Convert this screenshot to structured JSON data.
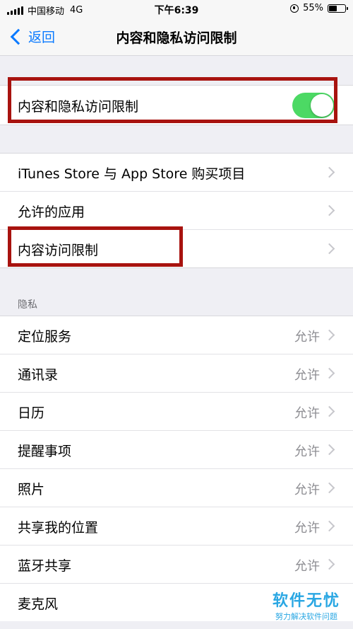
{
  "status_bar": {
    "carrier": "中国移动",
    "network": "4G",
    "time": "下午6:39",
    "battery": "55%",
    "battery_level": 0.55
  },
  "nav": {
    "back_label": "返回",
    "title": "内容和隐私访问限制"
  },
  "toggle_row": {
    "label": "内容和隐私访问限制",
    "enabled": true,
    "accent": "#4cd964"
  },
  "store_group": [
    {
      "label": "iTunes Store 与 App Store 购买项目"
    },
    {
      "label": "允许的应用"
    },
    {
      "label": "内容访问限制"
    }
  ],
  "privacy": {
    "header": "隐私",
    "items": [
      {
        "label": "定位服务",
        "value": "允许"
      },
      {
        "label": "通讯录",
        "value": "允许"
      },
      {
        "label": "日历",
        "value": "允许"
      },
      {
        "label": "提醒事项",
        "value": "允许"
      },
      {
        "label": "照片",
        "value": "允许"
      },
      {
        "label": "共享我的位置",
        "value": "允许"
      },
      {
        "label": "蓝牙共享",
        "value": "允许"
      },
      {
        "label": "麦克风",
        "value": ""
      }
    ]
  },
  "watermark": {
    "title": "软件无忧",
    "subtitle": "努力解决软件问题"
  },
  "colors": {
    "highlight": "#a8130f",
    "link": "#0a7aff"
  }
}
